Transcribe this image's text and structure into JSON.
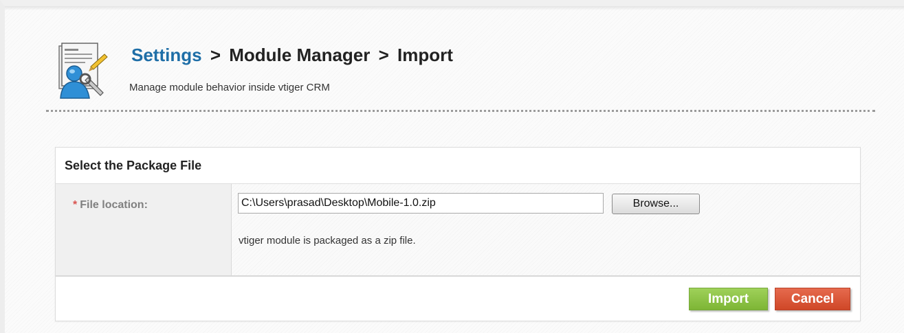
{
  "header": {
    "breadcrumb": [
      "Settings",
      "Module Manager",
      "Import"
    ],
    "separator": ">",
    "subtitle": "Manage module behavior inside vtiger CRM",
    "icon": "settings-tools-icon"
  },
  "panel": {
    "title": "Select the Package File",
    "field": {
      "required_marker": "*",
      "label": "File location:",
      "value": "C:\\Users\\prasad\\Desktop\\Mobile-1.0.zip",
      "browse_label": "Browse...",
      "help": "vtiger module is packaged as a zip file."
    },
    "actions": {
      "import_label": "Import",
      "cancel_label": "Cancel"
    }
  },
  "colors": {
    "link": "#1e6ea7",
    "import": "#8cc34a",
    "cancel": "#dd5533",
    "required": "#d9534f"
  }
}
